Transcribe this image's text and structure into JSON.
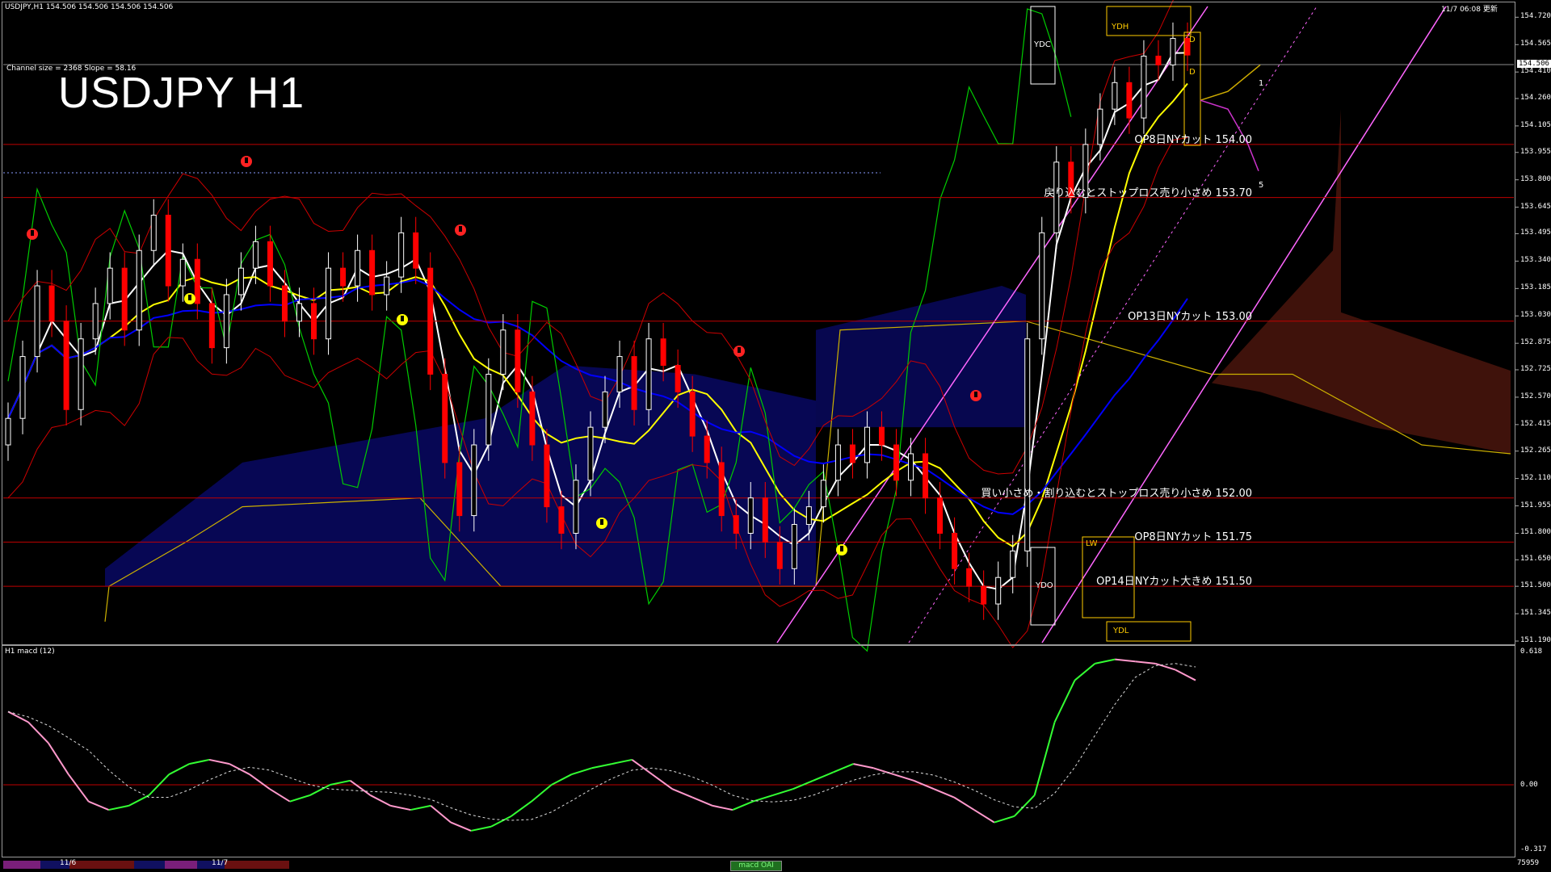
{
  "header": {
    "symbol_info": "USDJPY,H1  154.506 154.506 154.506 154.506",
    "channel_info": "Channel size = 2368 Slope = 58.16",
    "big_title": "USDJPY H1",
    "datetime": "11/7 06:08 更新"
  },
  "price_axis": {
    "ticks": [
      "154.720",
      "154.565",
      "154.410",
      "154.260",
      "154.105",
      "153.955",
      "153.800",
      "153.645",
      "153.495",
      "153.340",
      "153.185",
      "153.030",
      "152.875",
      "152.725",
      "152.570",
      "152.415",
      "152.265",
      "152.110",
      "151.955",
      "151.800",
      "151.650",
      "151.500",
      "151.345",
      "151.190"
    ],
    "current_price": "154.506",
    "range": [
      151.19,
      154.79
    ]
  },
  "macd_axis": {
    "top": "0.618",
    "zero": "0.00",
    "bottom": "-0.317",
    "panel_title": "H1  macd (12)",
    "bottom_right": "75959"
  },
  "levels": [
    {
      "price": 154.0,
      "label": "OP8日NYカット 154.00"
    },
    {
      "price": 153.7,
      "label": "戻り込むとストップロス売り小さめ 153.70"
    },
    {
      "price": 153.0,
      "label": "OP13日NYカット 153.00"
    },
    {
      "price": 152.0,
      "label": "買い小さめ・割り込むとストップロス売り小さめ 152.00"
    },
    {
      "price": 151.75,
      "label": "OP8日NYカット 151.75"
    },
    {
      "price": 151.5,
      "label": "OP14日NYカット大きめ 151.50"
    }
  ],
  "markers": {
    "ydc": "YDC",
    "ydh": "YDH",
    "ydo": "YDO",
    "ydl": "YDL",
    "d_upper": "D",
    "d_lower": "D",
    "wave1": "1",
    "wave5": "5",
    "lw": "LW"
  },
  "bottom_bar": {
    "date1": "11/6",
    "date2": "11/7",
    "tab": "macd OAI"
  },
  "colors": {
    "bull_candle": "#ffffff",
    "bear_candle": "#ff0000",
    "ma_white": "#ffffff",
    "ma_yellow": "#ffff00",
    "ma_blue": "#0000ff",
    "chikou": "#00cc00",
    "bollinger": "#cc0000",
    "level_line": "#c00000",
    "channel": "#ff66ff",
    "macd_up": "#33ff33",
    "macd_down": "#ff99cc"
  },
  "chart_data": {
    "type": "candlestick",
    "series": [
      {
        "name": "USDJPY H1",
        "close": [
          152.45,
          152.8,
          153.2,
          153.0,
          152.5,
          152.9,
          153.1,
          153.3,
          152.95,
          153.4,
          153.6,
          153.2,
          153.35,
          153.1,
          152.85,
          153.15,
          153.3,
          153.45,
          153.2,
          153.0,
          153.1,
          152.9,
          153.3,
          153.2,
          153.4,
          153.15,
          153.25,
          153.5,
          153.3,
          152.7,
          152.2,
          151.9,
          152.3,
          152.7,
          152.95,
          152.6,
          152.3,
          151.95,
          151.8,
          152.1,
          152.4,
          152.6,
          152.8,
          152.5,
          152.9,
          152.75,
          152.6,
          152.35,
          152.2,
          151.9,
          151.8,
          152.0,
          151.75,
          151.6,
          151.85,
          151.95,
          152.1,
          152.3,
          152.2,
          152.4,
          152.3,
          152.1,
          152.25,
          152.0,
          151.8,
          151.6,
          151.5,
          151.4,
          151.55,
          151.7,
          152.9,
          153.5,
          153.9,
          153.7,
          154.0,
          154.2,
          154.35,
          154.15,
          154.5,
          154.45,
          154.6,
          154.506
        ]
      }
    ]
  }
}
